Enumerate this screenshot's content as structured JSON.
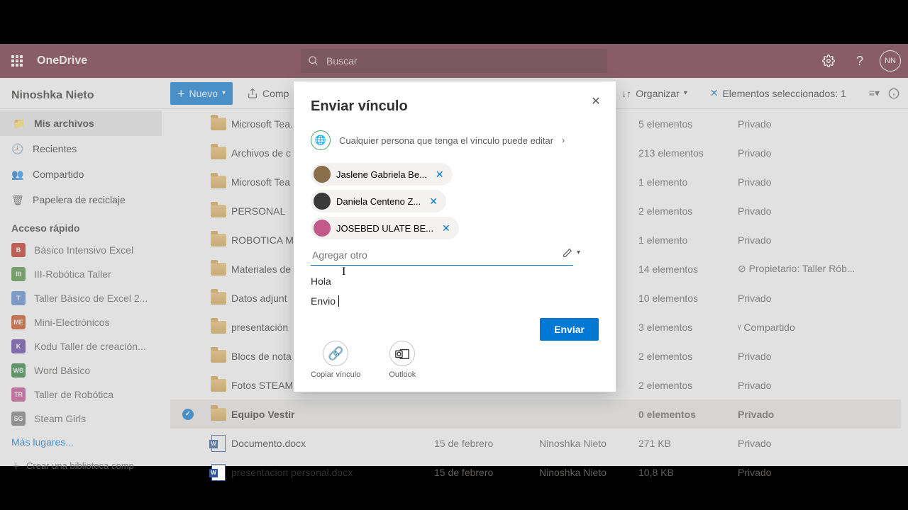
{
  "header": {
    "brand": "OneDrive",
    "search_placeholder": "Buscar",
    "avatar_initials": "NN"
  },
  "toolbar": {
    "nuevo": "Nuevo",
    "compartir": "Comp",
    "organizar": "Organizar",
    "seleccionados": "Elementos seleccionados: 1"
  },
  "sidebar": {
    "user": "Ninoshka Nieto",
    "items": [
      {
        "label": "Mis archivos"
      },
      {
        "label": "Recientes"
      },
      {
        "label": "Compartido"
      },
      {
        "label": "Papelera de reciclaje"
      }
    ],
    "quick_title": "Acceso rápido",
    "quick": [
      {
        "badge": "B",
        "color": "#c42b1c",
        "label": "Básico Intensivo Excel"
      },
      {
        "badge": "III",
        "color": "#4f8f3f",
        "label": "III-Robótica Taller"
      },
      {
        "badge": "T",
        "color": "#5b8bd6",
        "label": "Taller Básico de Excel 2..."
      },
      {
        "badge": "ME",
        "color": "#cb4b16",
        "label": "Mini-Electrónicos"
      },
      {
        "badge": "K",
        "color": "#5e3fa3",
        "label": "Kodu Taller de creación..."
      },
      {
        "badge": "WB",
        "color": "#2b7d3a",
        "label": "Word Básico"
      },
      {
        "badge": "TR",
        "color": "#c74a8f",
        "label": "Taller de Robótica"
      },
      {
        "badge": "SG",
        "color": "#7a7a7a",
        "label": "Steam Girls"
      }
    ],
    "more": "Más lugares...",
    "create": "Crear una biblioteca comp"
  },
  "files": [
    {
      "name": "Microsoft Tea...",
      "size": "5 elementos",
      "share": "Privado"
    },
    {
      "name": "Archivos de c",
      "size": "213 elementos",
      "share": "Privado"
    },
    {
      "name": "Microsoft Tea",
      "size": "1 elemento",
      "share": "Privado"
    },
    {
      "name": "PERSONAL",
      "size": "2 elementos",
      "share": "Privado"
    },
    {
      "name": "ROBOTICA M",
      "size": "1 elemento",
      "share": "Privado"
    },
    {
      "name": "Materiales de",
      "size": "14 elementos",
      "share": "⊘ Propietario: Taller Rób..."
    },
    {
      "name": "Datos adjunt",
      "size": "10 elementos",
      "share": "Privado"
    },
    {
      "name": "presentación",
      "size": "3 elementos",
      "share": "ᵞ Compartido"
    },
    {
      "name": "Blocs de nota",
      "size": "2 elementos",
      "share": "Privado"
    },
    {
      "name": "Fotos STEAM",
      "size": "2 elementos",
      "share": "Privado"
    },
    {
      "name": "Equipo Vestir",
      "size": "0 elementos",
      "share": "Privado",
      "selected": true
    },
    {
      "name": "Documento.docx",
      "mod": "15 de febrero",
      "by": "Ninoshka Nieto",
      "size": "271 KB",
      "share": "Privado",
      "type": "docx"
    },
    {
      "name": "presentacion personal.docx",
      "mod": "15 de febrero",
      "by": "Ninoshka Nieto",
      "size": "10,8 KB",
      "share": "Privado",
      "type": "docx"
    }
  ],
  "modal": {
    "title": "Enviar vínculo",
    "permission": "Cualquier persona que tenga el vínculo puede editar",
    "chips": [
      "Jaslene Gabriela Be...",
      "Daniela Centeno Z...",
      "JOSEBED ULATE BE..."
    ],
    "add_placeholder": "Agregar otro",
    "message_l1": "Hola",
    "message_l2": "Envio",
    "send": "Enviar",
    "copy": "Copiar vínculo",
    "outlook": "Outlook"
  }
}
